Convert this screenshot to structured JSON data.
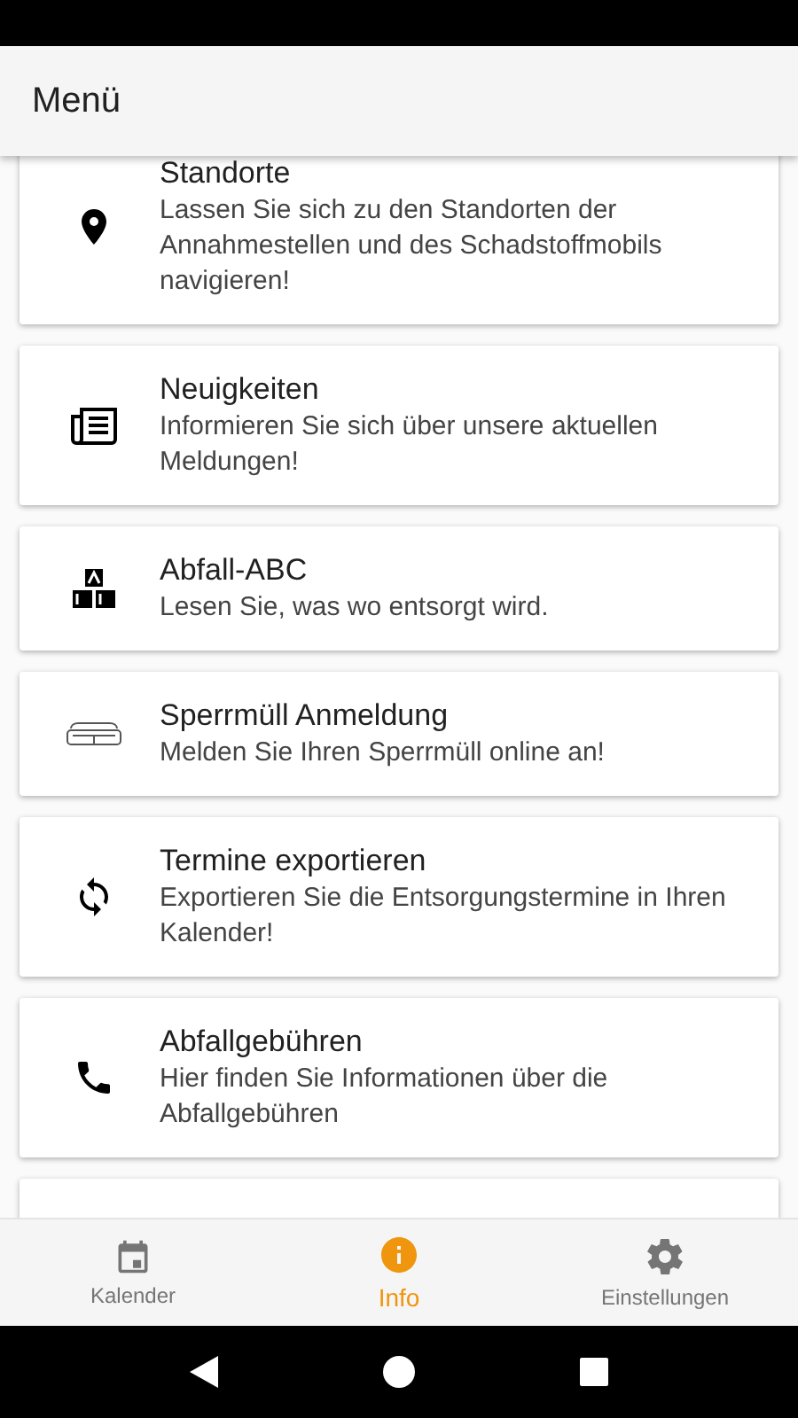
{
  "app_bar": {
    "title": "Menü"
  },
  "menu_items": [
    {
      "kind": "pin",
      "title": "Standorte",
      "description": "Lassen Sie sich zu den Standorten der Annahmestellen und des Schadstoffmobils navigieren!"
    },
    {
      "kind": "news",
      "title": "Neuigkeiten",
      "description": "Informieren Sie sich über unsere aktuellen Meldungen!"
    },
    {
      "kind": "blocks",
      "title": "Abfall-ABC",
      "description": "Lesen Sie, was wo entsorgt wird."
    },
    {
      "kind": "sofa",
      "title": "Sperrmüll Anmeldung",
      "description": "Melden Sie Ihren Sperrmüll online an!"
    },
    {
      "kind": "sync",
      "title": "Termine exportieren",
      "description": "Exportieren Sie die Entsorgungstermine in Ihren Kalender!"
    },
    {
      "kind": "phone",
      "title": "Abfallgebühren",
      "description": "Hier finden Sie Informationen über die Abfallgebühren"
    }
  ],
  "bottom_nav": [
    {
      "kind": "calendar",
      "label": "Kalender",
      "selected": false
    },
    {
      "kind": "info",
      "label": "Info",
      "selected": true
    },
    {
      "kind": "gear",
      "label": "Einstellungen",
      "selected": false
    }
  ]
}
